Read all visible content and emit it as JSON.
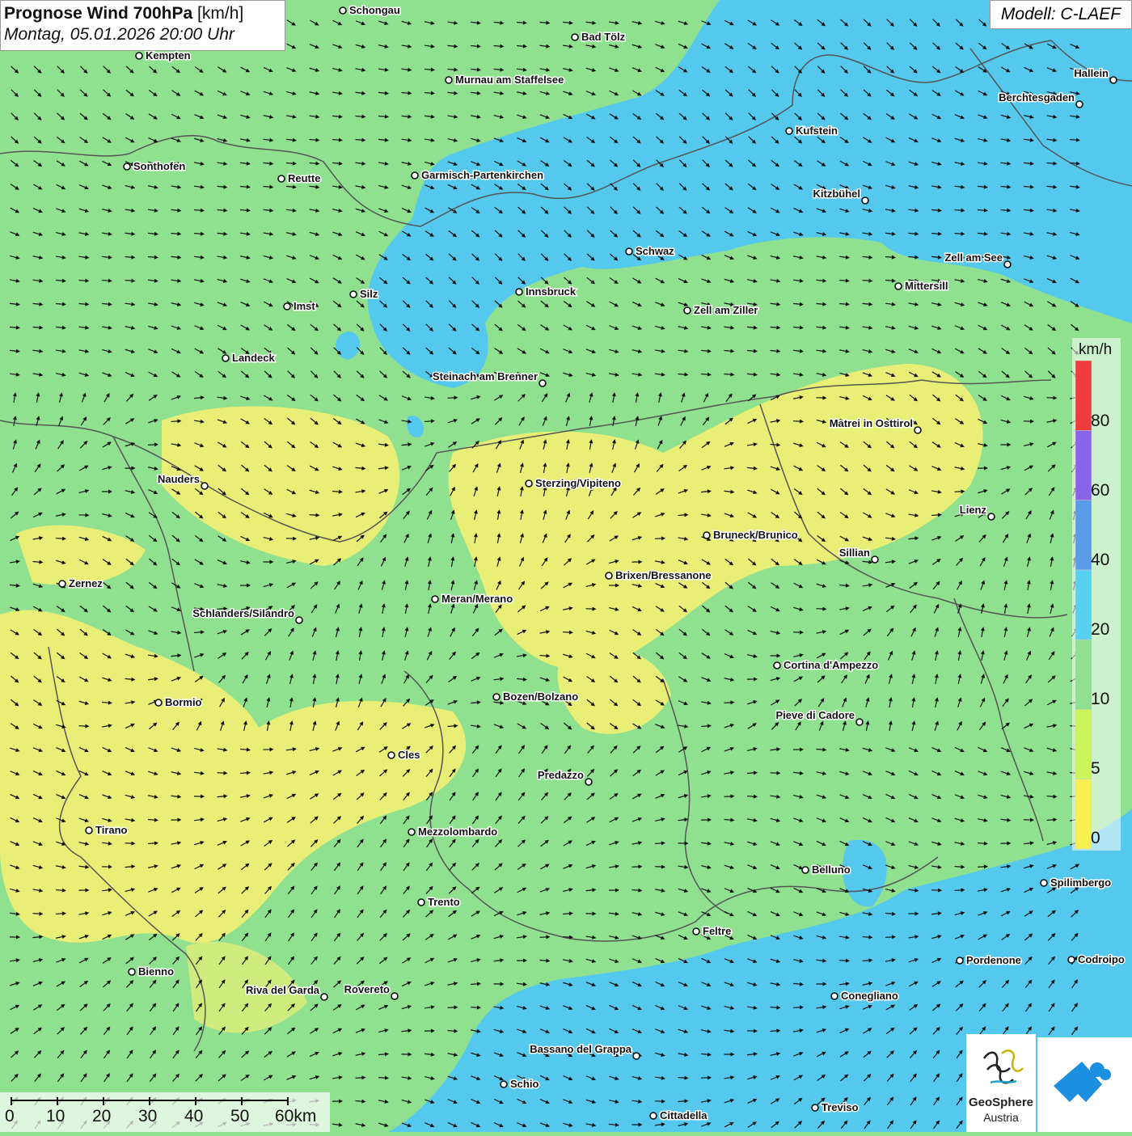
{
  "title": {
    "main": "Prognose Wind 700hPa",
    "unit": "[km/h]",
    "datetime": "Montag, 05.01.2026 20:00 Uhr"
  },
  "model": "Modell: C-LAEF",
  "legend": {
    "unit": "km/h",
    "ticks": [
      "0",
      "5",
      "10",
      "20",
      "40",
      "60",
      "80"
    ],
    "colors": [
      "#f8f050",
      "#ccf55a",
      "#8fe08f",
      "#58d0f0",
      "#5b9ce8",
      "#8a64e8",
      "#f03c3c"
    ]
  },
  "colors": {
    "calm_yellow": "#eff075",
    "light_green": "#8fe08f",
    "blue": "#55c8ee",
    "arrow": "#111111",
    "border": "#555555"
  },
  "cities": [
    {
      "name": "Schongau"
    },
    {
      "name": "Bad Tölz"
    },
    {
      "name": "Kempten"
    },
    {
      "name": "Murnau am Staffelsee"
    },
    {
      "name": "Hallein"
    },
    {
      "name": "Berchtesgaden"
    },
    {
      "name": "Kufstein"
    },
    {
      "name": "Sonthofen"
    },
    {
      "name": "Reutte"
    },
    {
      "name": "Garmisch-Partenkirchen"
    },
    {
      "name": "Kitzbühel"
    },
    {
      "name": "Schwaz"
    },
    {
      "name": "Zell am See"
    },
    {
      "name": "Mittersill"
    },
    {
      "name": "Silz"
    },
    {
      "name": "Innsbruck"
    },
    {
      "name": "Imst"
    },
    {
      "name": "Zell am Ziller"
    },
    {
      "name": "Landeck"
    },
    {
      "name": "Steinach am Brenner"
    },
    {
      "name": "Matrei in Osttirol"
    },
    {
      "name": "Nauders"
    },
    {
      "name": "Sterzing/Vipiteno"
    },
    {
      "name": "Lienz"
    },
    {
      "name": "Bruneck/Brunico"
    },
    {
      "name": "Sillian"
    },
    {
      "name": "Zernez"
    },
    {
      "name": "Brixen/Bressanone"
    },
    {
      "name": "Meran/Merano"
    },
    {
      "name": "Schlanders/Silandro"
    },
    {
      "name": "Cortina d'Ampezzo"
    },
    {
      "name": "Bormio"
    },
    {
      "name": "Bozen/Bolzano"
    },
    {
      "name": "Pieve di Cadore"
    },
    {
      "name": "Cles"
    },
    {
      "name": "Predazzo"
    },
    {
      "name": "Tirano"
    },
    {
      "name": "Mezzolombardo"
    },
    {
      "name": "Belluno"
    },
    {
      "name": "Spilimbergo"
    },
    {
      "name": "Trento"
    },
    {
      "name": "Feltre"
    },
    {
      "name": "Bienno"
    },
    {
      "name": "Pordenone"
    },
    {
      "name": "Codroipo"
    },
    {
      "name": "Riva del Garda"
    },
    {
      "name": "Rovereto"
    },
    {
      "name": "Conegliano"
    },
    {
      "name": "Bassano del Grappa"
    },
    {
      "name": "Schio"
    },
    {
      "name": "Treviso"
    },
    {
      "name": "Cittadella"
    }
  ],
  "scale": {
    "ticks": [
      "0",
      "10",
      "20",
      "30",
      "40",
      "50",
      "60km"
    ]
  },
  "logos": {
    "geosphere_line1": "GeoSphere",
    "geosphere_line2": "Austria"
  }
}
